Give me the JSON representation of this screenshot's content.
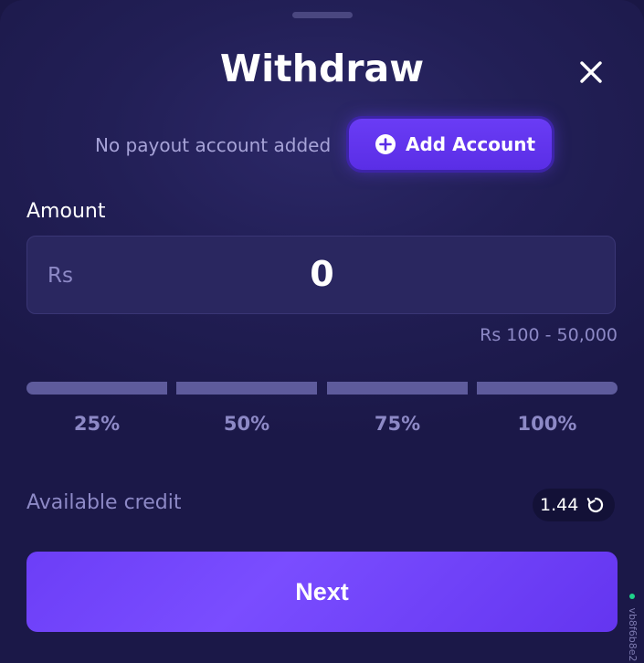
{
  "modal": {
    "title": "Withdraw",
    "close_icon": "close-icon"
  },
  "payout": {
    "status_text": "No payout account added",
    "add_button_label": "Add Account",
    "add_icon": "plus-circle-icon"
  },
  "amount": {
    "label": "Amount",
    "currency": "Rs",
    "value": "0",
    "range_hint": "Rs 100 - 50,000"
  },
  "percent_options": [
    {
      "label": "25%"
    },
    {
      "label": "50%"
    },
    {
      "label": "75%"
    },
    {
      "label": "100%"
    }
  ],
  "credit": {
    "label": "Available credit",
    "value": "1.44",
    "refresh_icon": "refresh-icon"
  },
  "actions": {
    "next_label": "Next"
  },
  "build_tag": "vb8f6b8e2",
  "colors": {
    "background": "#1b1848",
    "accent": "#6c3ef7",
    "bar": "#5e5b9c",
    "muted_text": "#8d89c6",
    "status_dot": "#1fd28a"
  }
}
